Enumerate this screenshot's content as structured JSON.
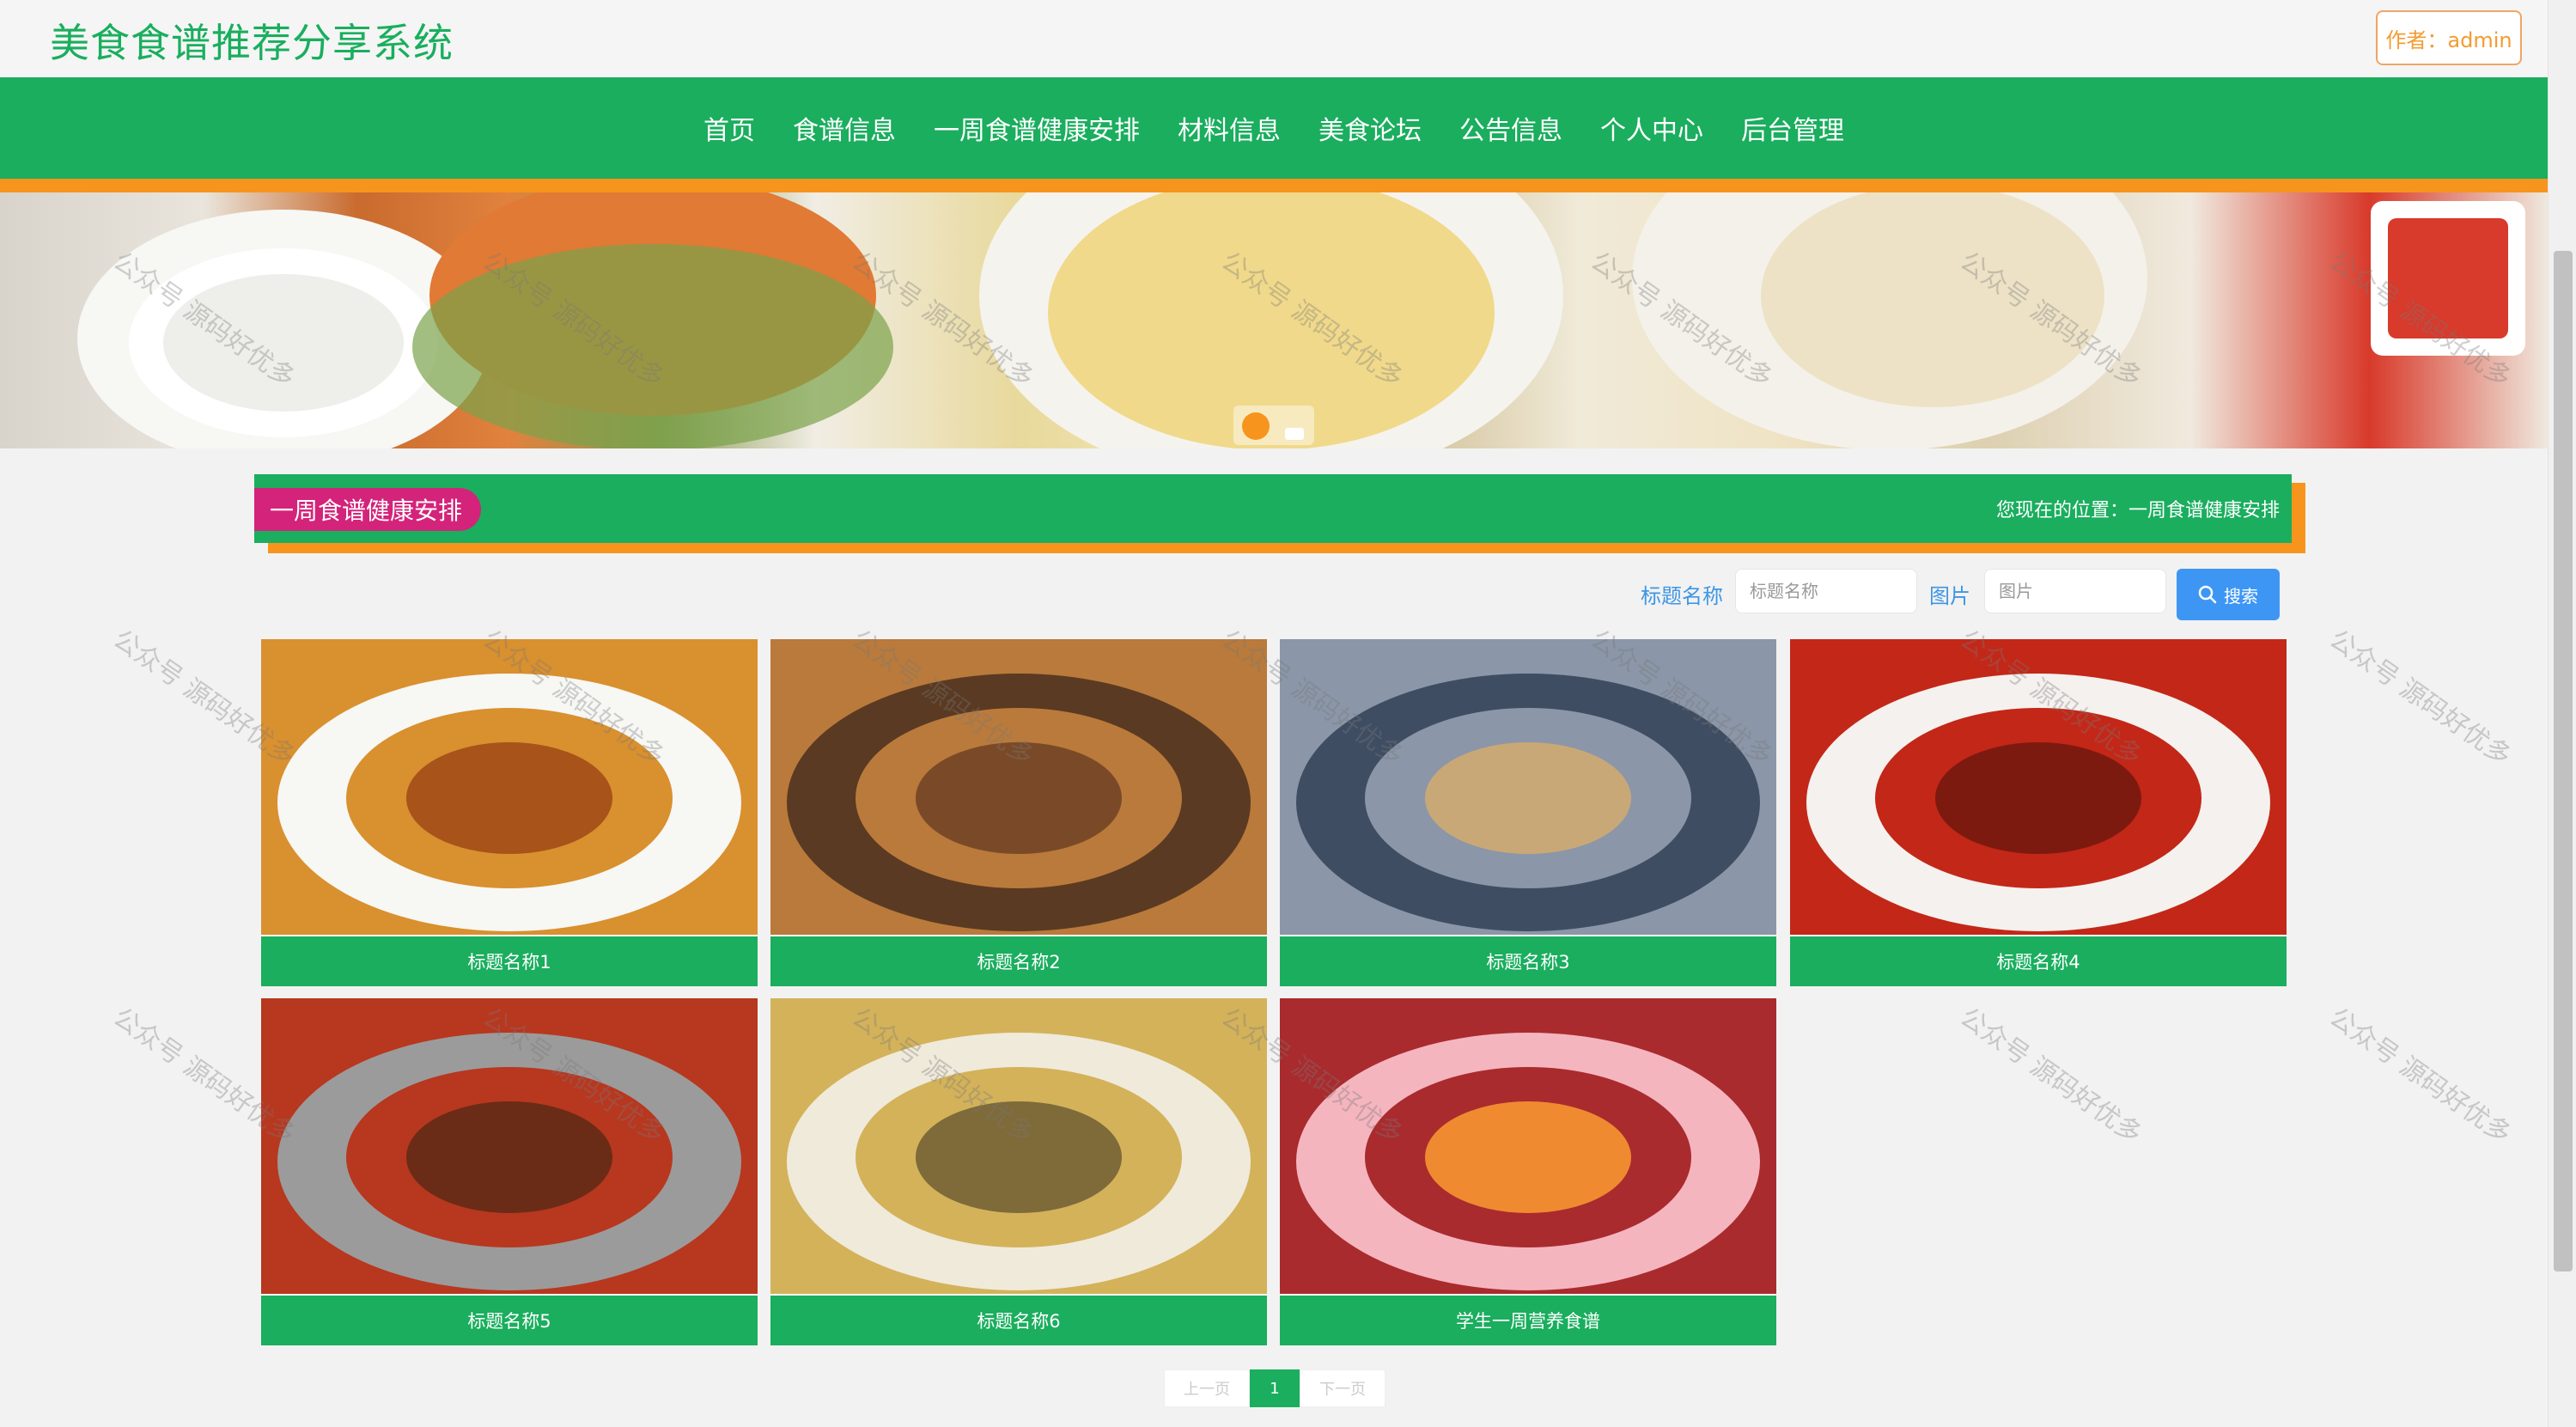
{
  "header": {
    "site_title": "美食食谱推荐分享系统",
    "author_label": "作者：admin"
  },
  "nav": {
    "items": [
      {
        "label": "首页"
      },
      {
        "label": "食谱信息"
      },
      {
        "label": "一周食谱健康安排"
      },
      {
        "label": "材料信息"
      },
      {
        "label": "美食论坛"
      },
      {
        "label": "公告信息"
      },
      {
        "label": "个人中心"
      },
      {
        "label": "后台管理"
      }
    ]
  },
  "section": {
    "title": "一周食谱健康安排",
    "breadcrumb": "您现在的位置：一周食谱健康安排"
  },
  "search": {
    "title_label": "标题名称",
    "title_placeholder": "标题名称",
    "image_label": "图片",
    "image_placeholder": "图片",
    "button_label": "搜索"
  },
  "cards": [
    {
      "caption": "标题名称1",
      "colors": [
        "#f7f7f4",
        "#d9902e",
        "#a8531a"
      ]
    },
    {
      "caption": "标题名称2",
      "colors": [
        "#5a3a22",
        "#b97a3b",
        "#7a4a28"
      ]
    },
    {
      "caption": "标题名称3",
      "colors": [
        "#3f4d63",
        "#8b96a8",
        "#c9a877"
      ]
    },
    {
      "caption": "标题名称4",
      "colors": [
        "#f4f1ee",
        "#c32718",
        "#7d1a10"
      ]
    },
    {
      "caption": "标题名称5",
      "colors": [
        "#9b9b9b",
        "#b8371f",
        "#6a2c16"
      ]
    },
    {
      "caption": "标题名称6",
      "colors": [
        "#f0eadb",
        "#d3b25a",
        "#7f6a3a"
      ]
    },
    {
      "caption": "学生一周营养食谱",
      "colors": [
        "#f5b5bf",
        "#a92b2e",
        "#f08a30"
      ]
    }
  ],
  "pagination": {
    "prev_label": "上一页",
    "current_page": "1",
    "next_label": "下一页"
  },
  "watermark_text": "公众号 源码好优多"
}
